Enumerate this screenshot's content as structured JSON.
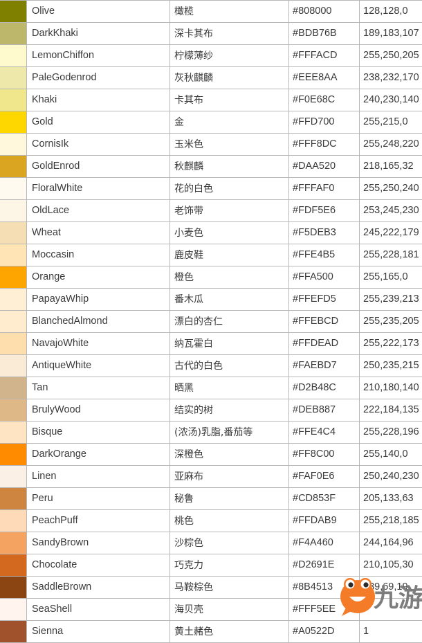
{
  "table": {
    "columns": [
      "swatch",
      "english_name",
      "chinese_name",
      "hex",
      "rgb"
    ],
    "rows": [
      {
        "name": "Olive",
        "cn": "橄榄",
        "hex": "#808000",
        "rgb": "128,128,0",
        "swatch": "#808000"
      },
      {
        "name": "DarkKhaki",
        "cn": "深卡其布",
        "hex": "#BDB76B",
        "rgb": "189,183,107",
        "swatch": "#BDB76B"
      },
      {
        "name": "LemonChiffon",
        "cn": "柠檬薄纱",
        "hex": "#FFFACD",
        "rgb": "255,250,205",
        "swatch": "#FFFACD"
      },
      {
        "name": "PaleGodenrod",
        "cn": "灰秋麒麟",
        "hex": "#EEE8AA",
        "rgb": "238,232,170",
        "swatch": "#EEE8AA"
      },
      {
        "name": "Khaki",
        "cn": "卡其布",
        "hex": "#F0E68C",
        "rgb": "240,230,140",
        "swatch": "#F0E68C"
      },
      {
        "name": "Gold",
        "cn": "金",
        "hex": "#FFD700",
        "rgb": "255,215,0",
        "swatch": "#FFD700"
      },
      {
        "name": "CornisIk",
        "cn": "玉米色",
        "hex": "#FFF8DC",
        "rgb": "255,248,220",
        "swatch": "#FFF8DC"
      },
      {
        "name": "GoldEnrod",
        "cn": "秋麒麟",
        "hex": "#DAA520",
        "rgb": "218,165,32",
        "swatch": "#DAA520"
      },
      {
        "name": "FloralWhite",
        "cn": "花的白色",
        "hex": "#FFFAF0",
        "rgb": "255,250,240",
        "swatch": "#FFFAF0"
      },
      {
        "name": "OldLace",
        "cn": "老饰带",
        "hex": "#FDF5E6",
        "rgb": "253,245,230",
        "swatch": "#FDF5E6"
      },
      {
        "name": "Wheat",
        "cn": "小麦色",
        "hex": "#F5DEB3",
        "rgb": "245,222,179",
        "swatch": "#F5DEB3"
      },
      {
        "name": "Moccasin",
        "cn": "鹿皮鞋",
        "hex": "#FFE4B5",
        "rgb": "255,228,181",
        "swatch": "#FFE4B5"
      },
      {
        "name": "Orange",
        "cn": "橙色",
        "hex": "#FFA500",
        "rgb": "255,165,0",
        "swatch": "#FFA500"
      },
      {
        "name": "PapayaWhip",
        "cn": "番木瓜",
        "hex": "#FFEFD5",
        "rgb": "255,239,213",
        "swatch": "#FFEFD5"
      },
      {
        "name": "BlanchedAlmond",
        "cn": "漂白的杏仁",
        "hex": "#FFEBCD",
        "rgb": "255,235,205",
        "swatch": "#FFEBCD"
      },
      {
        "name": "NavajoWhite",
        "cn": "纳瓦霍白",
        "hex": "#FFDEAD",
        "rgb": "255,222,173",
        "swatch": "#FFDEAD"
      },
      {
        "name": "AntiqueWhite",
        "cn": "古代的白色",
        "hex": "#FAEBD7",
        "rgb": "250,235,215",
        "swatch": "#FAEBD7"
      },
      {
        "name": "Tan",
        "cn": "晒黑",
        "hex": "#D2B48C",
        "rgb": "210,180,140",
        "swatch": "#D2B48C"
      },
      {
        "name": "BrulyWood",
        "cn": "结实的树",
        "hex": "#DEB887",
        "rgb": "222,184,135",
        "swatch": "#DEB887"
      },
      {
        "name": "Bisque",
        "cn": "(浓汤)乳脂,番茄等",
        "hex": "#FFE4C4",
        "rgb": "255,228,196",
        "swatch": "#FFE4C4"
      },
      {
        "name": "DarkOrange",
        "cn": "深橙色",
        "hex": "#FF8C00",
        "rgb": "255,140,0",
        "swatch": "#FF8C00"
      },
      {
        "name": "Linen",
        "cn": "亚麻布",
        "hex": "#FAF0E6",
        "rgb": "250,240,230",
        "swatch": "#FAF0E6"
      },
      {
        "name": "Peru",
        "cn": "秘鲁",
        "hex": "#CD853F",
        "rgb": "205,133,63",
        "swatch": "#CD853F"
      },
      {
        "name": "PeachPuff",
        "cn": "桃色",
        "hex": "#FFDAB9",
        "rgb": "255,218,185",
        "swatch": "#FFDAB9"
      },
      {
        "name": "SandyBrown",
        "cn": "沙棕色",
        "hex": "#F4A460",
        "rgb": "244,164,96",
        "swatch": "#F4A460"
      },
      {
        "name": "Chocolate",
        "cn": "巧克力",
        "hex": "#D2691E",
        "rgb": "210,105,30",
        "swatch": "#D2691E"
      },
      {
        "name": "SaddleBrown",
        "cn": "马鞍棕色",
        "hex": "#8B4513",
        "rgb": "139,69,19",
        "swatch": "#8B4513"
      },
      {
        "name": "SeaShell",
        "cn": "海贝壳",
        "hex": "#FFF5EE",
        "rgb": "",
        "swatch": "#FFF5EE"
      },
      {
        "name": "Sienna",
        "cn": "黄土赭色",
        "hex": "#A0522D",
        "rgb": "1",
        "swatch": "#A0522D"
      }
    ]
  },
  "watermark": {
    "text": "九游",
    "mascot_color": "#F47B28",
    "text_color": "#7d7d7d"
  }
}
